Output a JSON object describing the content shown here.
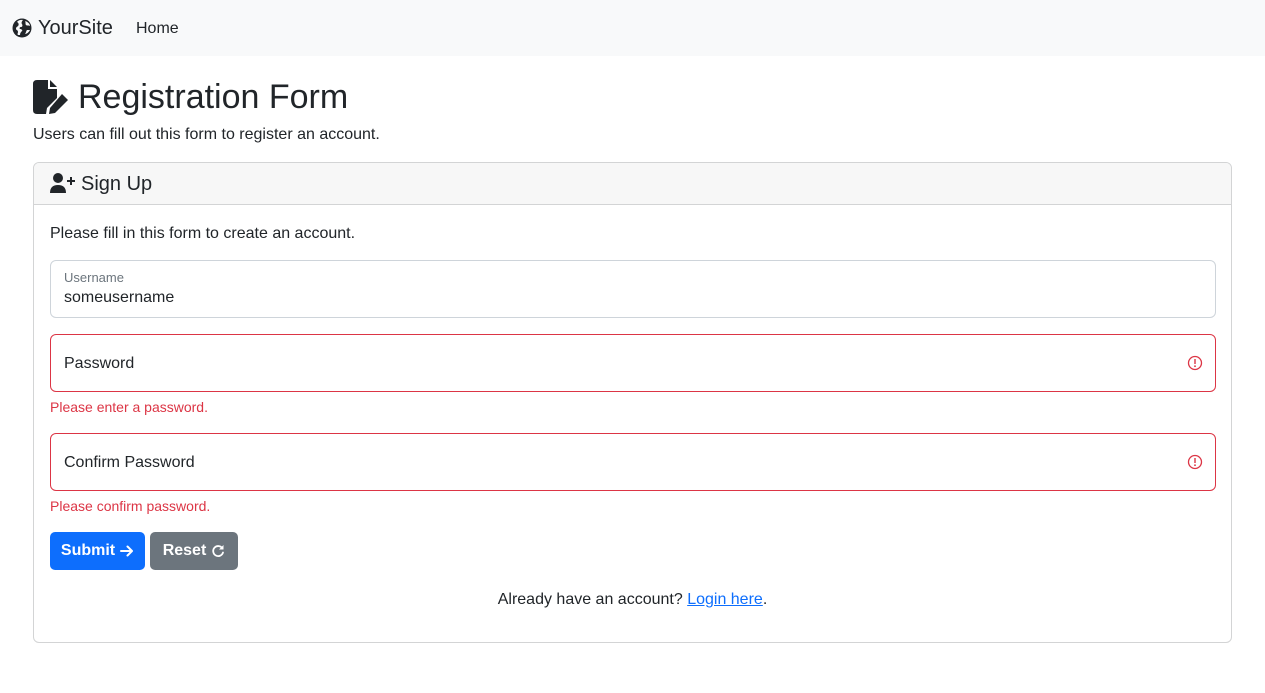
{
  "navbar": {
    "brand_icon": "globe-icon",
    "brand": "YourSite",
    "home_link": "Home"
  },
  "page": {
    "title_icon": "file-pen-icon",
    "title": "Registration Form",
    "lead": "Users can fill out this form to register an account."
  },
  "card": {
    "header_icon": "user-plus-icon",
    "header": "Sign Up",
    "intro": "Please fill in this form to create an account.",
    "fields": {
      "username": {
        "label": "Username",
        "value": "someusername"
      },
      "password": {
        "label": "Password",
        "value": "",
        "error": "Please enter a password."
      },
      "confirm": {
        "label": "Confirm Password",
        "value": "",
        "error": "Please confirm password."
      }
    },
    "buttons": {
      "submit": "Submit",
      "submit_icon": "arrow-right-icon",
      "reset": "Reset",
      "reset_icon": "rotate-right-icon"
    },
    "login": {
      "prompt": "Already have an account? ",
      "link": "Login here",
      "suffix": "."
    }
  },
  "colors": {
    "primary": "#0d6efd",
    "secondary": "#6c757d",
    "danger": "#dc3545",
    "navbar_bg": "#f8f9fa"
  }
}
